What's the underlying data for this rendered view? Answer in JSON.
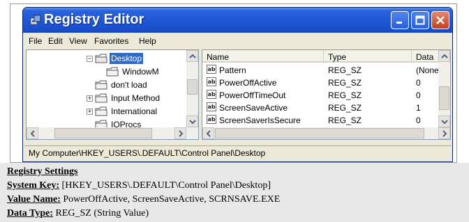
{
  "window": {
    "title": "Registry Editor",
    "menu": [
      "File",
      "Edit",
      "View",
      "Favorites",
      "Help"
    ]
  },
  "tree": {
    "nodes": [
      {
        "label": "Desktop",
        "expander": "−",
        "selected": true
      },
      {
        "label": "WindowM",
        "expander": ""
      },
      {
        "label": "don't load",
        "expander": ""
      },
      {
        "label": "Input Method",
        "expander": "+"
      },
      {
        "label": "International",
        "expander": "+"
      },
      {
        "label": "IOProcs",
        "expander": ""
      }
    ]
  },
  "list": {
    "columns": [
      "Name",
      "Type",
      "Data"
    ],
    "rows": [
      {
        "icon": "ab",
        "name": "Pattern",
        "type": "REG_SZ",
        "data": "(None)"
      },
      {
        "icon": "ab",
        "name": "PowerOffActive",
        "type": "REG_SZ",
        "data": "0"
      },
      {
        "icon": "ab",
        "name": "PowerOffTimeOut",
        "type": "REG_SZ",
        "data": "0"
      },
      {
        "icon": "ab",
        "name": "ScreenSaveActive",
        "type": "REG_SZ",
        "data": "1"
      },
      {
        "icon": "ab",
        "name": "ScreenSaverIsSecure",
        "type": "REG_SZ",
        "data": "0"
      }
    ]
  },
  "status": {
    "path": "My Computer\\HKEY_USERS\\.DEFAULT\\Control Panel\\Desktop"
  },
  "settings": {
    "heading": "Registry Settings",
    "system_key_label": "System Key:",
    "system_key": "[HKEY_USERS\\.DEFAULT\\Control Panel\\Desktop]",
    "value_name_label": "Value Name:",
    "value_name": "PowerOffActive, ScreenSaveActive, SCRNSAVE.EXE",
    "data_type_label": "Data Type:",
    "data_type": "REG_SZ (String Value)"
  },
  "colors": {
    "title_blue": "#1f56d4",
    "selection": "#316ac5",
    "window_face": "#ece9d8"
  },
  "icons": [
    "registry-app-icon",
    "minimize-icon",
    "maximize-icon",
    "close-icon",
    "folder-icon",
    "string-value-icon"
  ]
}
